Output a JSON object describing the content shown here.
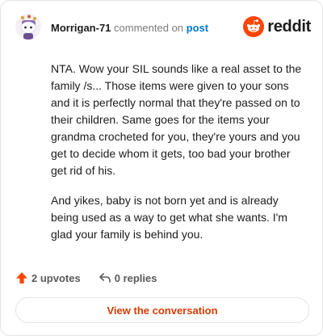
{
  "comment": {
    "username": "Morrigan-71",
    "action": "commented on",
    "target": "post",
    "paragraphs": [
      "NTA. Wow your SIL sounds like a real asset to the family /s... Those items were given to your sons and it is perfectly normal that they're passed on to their children. Same goes for the items your grandma crocheted for you, they're yours and you get to decide whom it gets, too bad your brother get rid of his.",
      "And yikes, baby is not born yet and is already being used as a way to get what she wants. I'm glad your family is behind you."
    ]
  },
  "brand": {
    "name": "reddit",
    "accent": "#ff4500",
    "link_color": "#0079d3"
  },
  "stats": {
    "upvotes": "2 upvotes",
    "replies": "0 replies"
  },
  "cta": {
    "label": "View the conversation"
  },
  "icons": {
    "avatar": "snoo-avatar-icon",
    "logo": "reddit-logo-icon",
    "upvote": "upvote-arrow-icon",
    "reply": "reply-arrow-icon"
  }
}
